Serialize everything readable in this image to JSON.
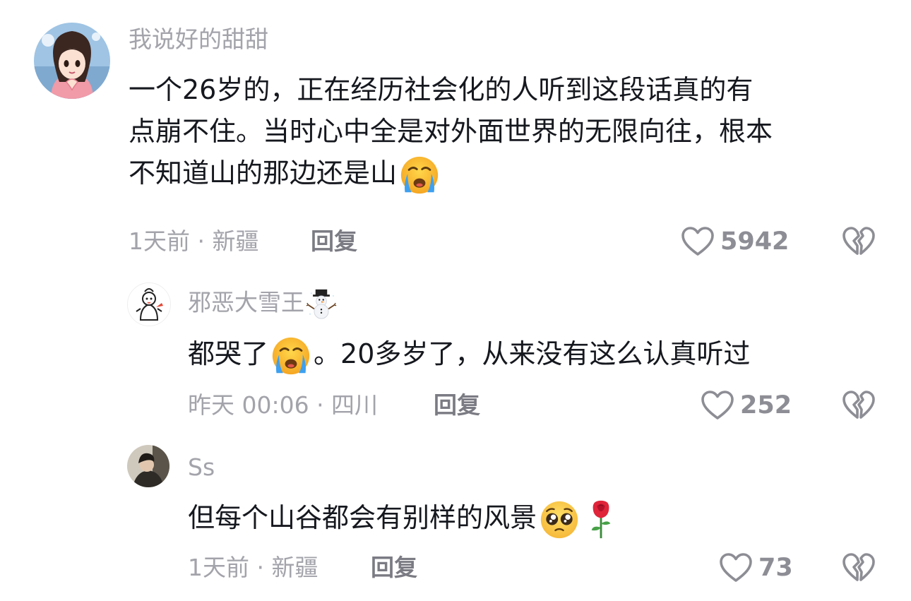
{
  "comments": [
    {
      "username": "我说好的甜甜",
      "lines": [
        "一个26岁的，正在经历社会化的人听到这段话真的有",
        "点崩不住。当时心中全是对外面世界的无限向往，根本",
        "不知道山的那边还是山"
      ],
      "emoji_after": "loudly-crying-face",
      "meta": "1天前 · 新疆",
      "reply_label": "回复",
      "like_count": "5942"
    },
    {
      "username": "邪恶大雪王",
      "username_emoji": "snowman-icon",
      "text_before": "都哭了",
      "text_after": "。20多岁了，从来没有这么认真听过",
      "meta": "昨天 00:06 · 四川",
      "reply_label": "回复",
      "like_count": "252"
    },
    {
      "username": "Ss",
      "text": "但每个山谷都会有别样的风景",
      "meta": "1天前 · 新疆",
      "reply_label": "回复",
      "like_count": "73"
    }
  ],
  "colors": {
    "text": "#16181f",
    "muted": "#a3a3ab",
    "reply": "#7b7b84",
    "icon": "#8d8d95"
  }
}
